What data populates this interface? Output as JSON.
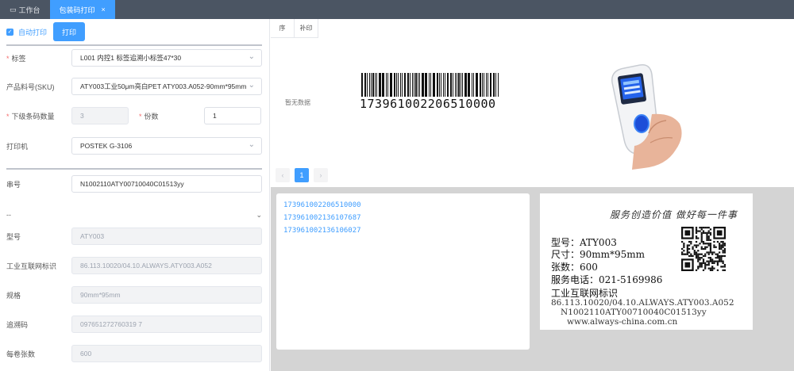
{
  "tabs": [
    {
      "label": "工作台",
      "icon": "desktop-icon"
    },
    {
      "label": "包装码打印",
      "close": "×"
    }
  ],
  "toolbar": {
    "auto_print": "自动打印",
    "print": "打印"
  },
  "form": {
    "label": {
      "name": "标签",
      "value": "L001    内控1 标签追溯小标签47*30"
    },
    "sku": {
      "name": "产品料号(SKU)",
      "value": "ATY003工业50μm亮白PET    ATY003.A052-90mm*95mm"
    },
    "sub_count": {
      "name": "下级条码数量",
      "value": "3"
    },
    "copies": {
      "name": "份数",
      "value": "1"
    },
    "printer": {
      "name": "打印机",
      "value": "POSTEK G-3106"
    },
    "serial": {
      "name": "串号",
      "value": "N1002110ATY00710040C01513yy"
    },
    "collapse_label": "--",
    "model": {
      "name": "型号",
      "value": "ATY003"
    },
    "iot_id": {
      "name": "工业互联网标识",
      "value": "86.113.10020/04.10.ALWAYS.ATY003.A052"
    },
    "spec": {
      "name": "规格",
      "value": "90mm*95mm"
    },
    "trace": {
      "name": "追溯码",
      "value": "097651272760319 7"
    },
    "per_roll": {
      "name": "每卷张数",
      "value": "600"
    }
  },
  "preview": {
    "tabs": [
      "序",
      "补印"
    ],
    "no_data": "暂无数据",
    "barcode_number": "173961002206510000",
    "page": "1",
    "prev": "‹",
    "next": "›"
  },
  "codes": [
    "173961002206510000",
    "173961002136107687",
    "173961002136106027"
  ],
  "label_card": {
    "slogan": "服务创造价值  做好每一件事",
    "model": "型号：ATY003",
    "size": "尺寸：90mm*95mm",
    "count": "张数：600",
    "phone": "服务电话：021-5169986",
    "iot_title": "工业互联网标识",
    "iot_value": "86.113.10020/04.10.ALWAYS.ATY003.A052",
    "serial": "N1002110ATY00710040C01513yy",
    "site": "www.always-china.com.cn"
  },
  "colors": {
    "accent": "#409eff",
    "topbar": "#4b5563",
    "required": "#f56c6c"
  }
}
